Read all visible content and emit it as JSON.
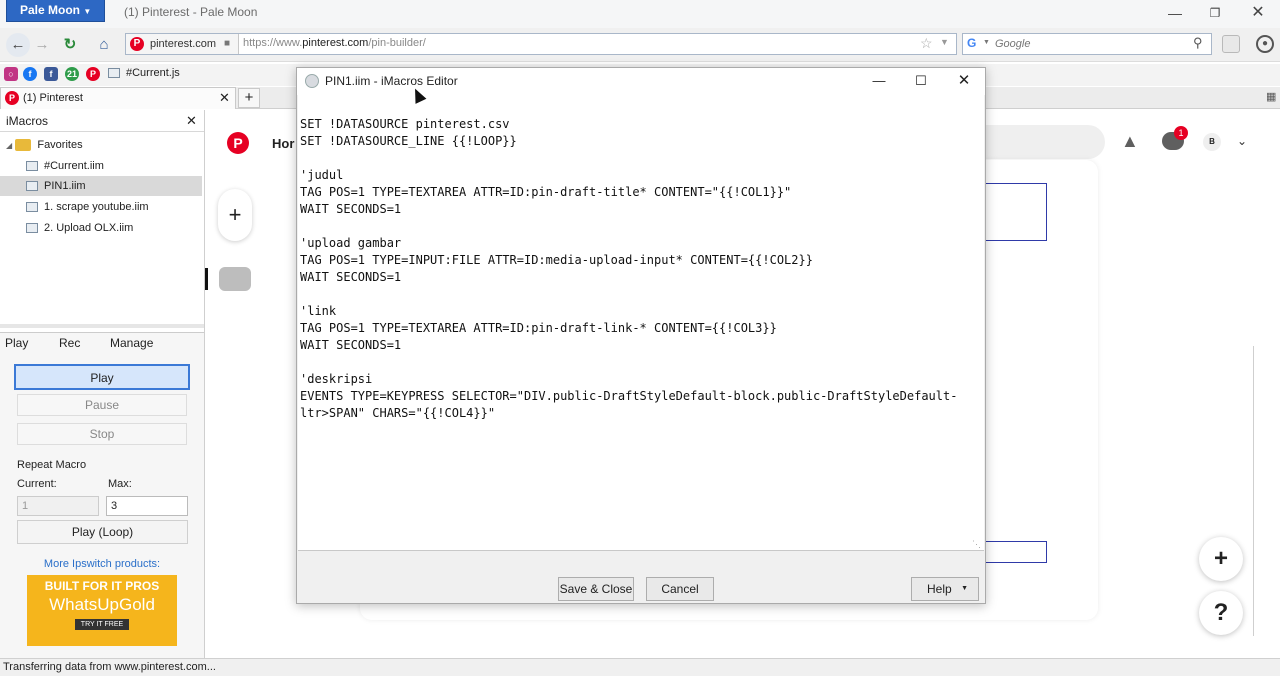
{
  "browser": {
    "menu_label": "Pale Moon",
    "window_title": "(1) Pinterest - Pale Moon",
    "identity_host": "pinterest.com",
    "url_prefix": "https://www.",
    "url_domain": "pinterest.com",
    "url_path": "/pin-builder/",
    "search_placeholder": "Google",
    "bookmarks": [
      {
        "label": "#Current.js"
      }
    ],
    "tab_label": "(1) Pinterest",
    "status_text": "Transferring data from www.pinterest.com..."
  },
  "sidebar": {
    "title": "iMacros",
    "tree": [
      {
        "label": "Favorites"
      },
      {
        "label": "#Current.iim"
      },
      {
        "label": "PIN1.iim"
      },
      {
        "label": "1. scrape youtube.iim"
      },
      {
        "label": "2. Upload OLX.iim"
      }
    ],
    "tabs": [
      "Play",
      "Rec",
      "Manage"
    ],
    "play": "Play",
    "pause": "Pause",
    "stop": "Stop",
    "repeat_label": "Repeat Macro",
    "current_label": "Current:",
    "max_label": "Max:",
    "current_value": "1",
    "max_value": "3",
    "play_loop": "Play (Loop)",
    "more_products": "More Ipswitch products:",
    "ad_line1": "BUILT FOR IT PROS",
    "ad_line2": "WhatsUpGold",
    "ad_cta": "TRY IT FREE"
  },
  "pinterest": {
    "home_partial": "Hor",
    "notification_count": "1",
    "avatar_letter": "B"
  },
  "editor": {
    "title": "PIN1.iim - iMacros Editor",
    "code": "SET !DATASOURCE pinterest.csv\nSET !DATASOURCE_LINE {{!LOOP}}\n\n'judul\nTAG POS=1 TYPE=TEXTAREA ATTR=ID:pin-draft-title* CONTENT=\"{{!COL1}}\"\nWAIT SECONDS=1\n\n'upload gambar\nTAG POS=1 TYPE=INPUT:FILE ATTR=ID:media-upload-input* CONTENT={{!COL2}}\nWAIT SECONDS=1\n\n'link\nTAG POS=1 TYPE=TEXTAREA ATTR=ID:pin-draft-link-* CONTENT={{!COL3}}\nWAIT SECONDS=1\n\n'deskripsi\nEVENTS TYPE=KEYPRESS SELECTOR=\"DIV.public-DraftStyleDefault-block.public-DraftStyleDefault-\nltr>SPAN\" CHARS=\"{{!COL4}}\"",
    "save_close": "Save & Close",
    "cancel": "Cancel",
    "help": "Help"
  }
}
